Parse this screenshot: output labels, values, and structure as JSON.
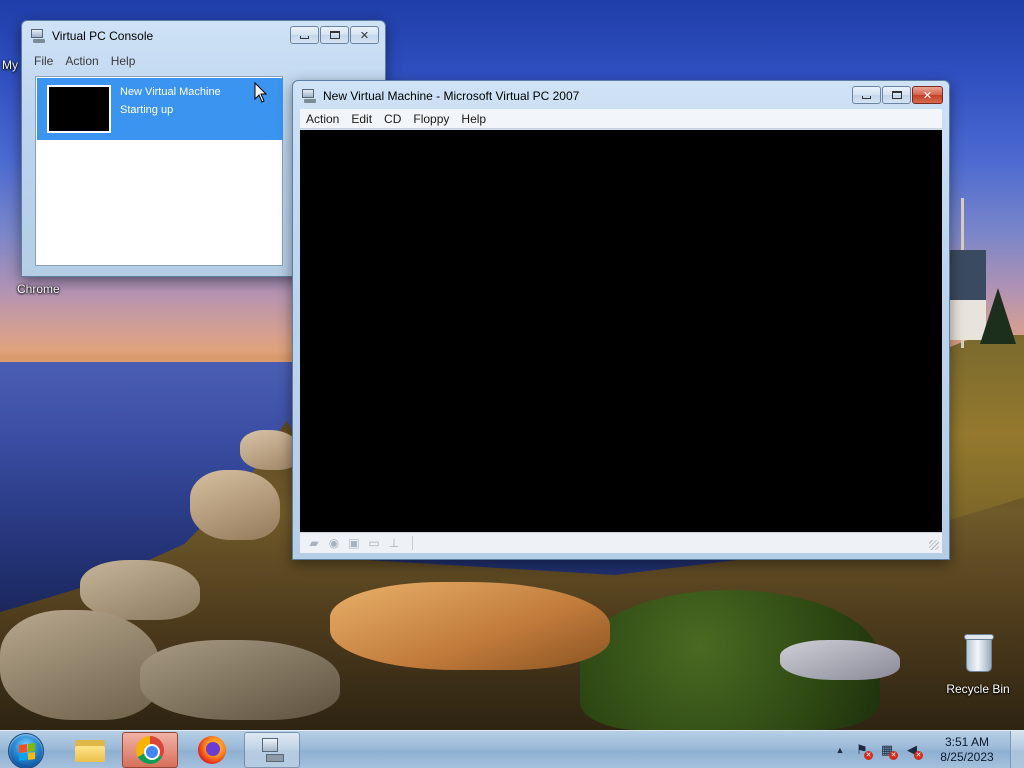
{
  "desktop": {
    "icons": [
      {
        "label": "My",
        "name": "computer"
      },
      {
        "label": "Chrome",
        "name": "chrome"
      },
      {
        "label": "Recycle Bin",
        "name": "recycle-bin"
      }
    ]
  },
  "console_window": {
    "title": "Virtual PC Console",
    "menu": [
      "File",
      "Action",
      "Help"
    ],
    "vm": {
      "name": "New Virtual Machine",
      "status": "Starting up"
    }
  },
  "vm_window": {
    "title": "New Virtual Machine - Microsoft Virtual PC 2007",
    "menu": [
      "Action",
      "Edit",
      "CD",
      "Floppy",
      "Help"
    ],
    "status_icons": [
      "hard-disk-icon",
      "cd-icon",
      "floppy-icon",
      "shared-folder-icon",
      "network-icon"
    ]
  },
  "taskbar": {
    "pinned": [
      "explorer",
      "chrome",
      "firefox",
      "virtual-pc"
    ],
    "clock": {
      "time": "3:51 AM",
      "date": "8/25/2023"
    },
    "tray_icons": [
      "action-center-icon",
      "network-icon",
      "volume-muted-icon"
    ]
  },
  "colors": {
    "selection": "#3b94ef",
    "close_button": "#c3412a",
    "vm_screen": "#000000"
  }
}
